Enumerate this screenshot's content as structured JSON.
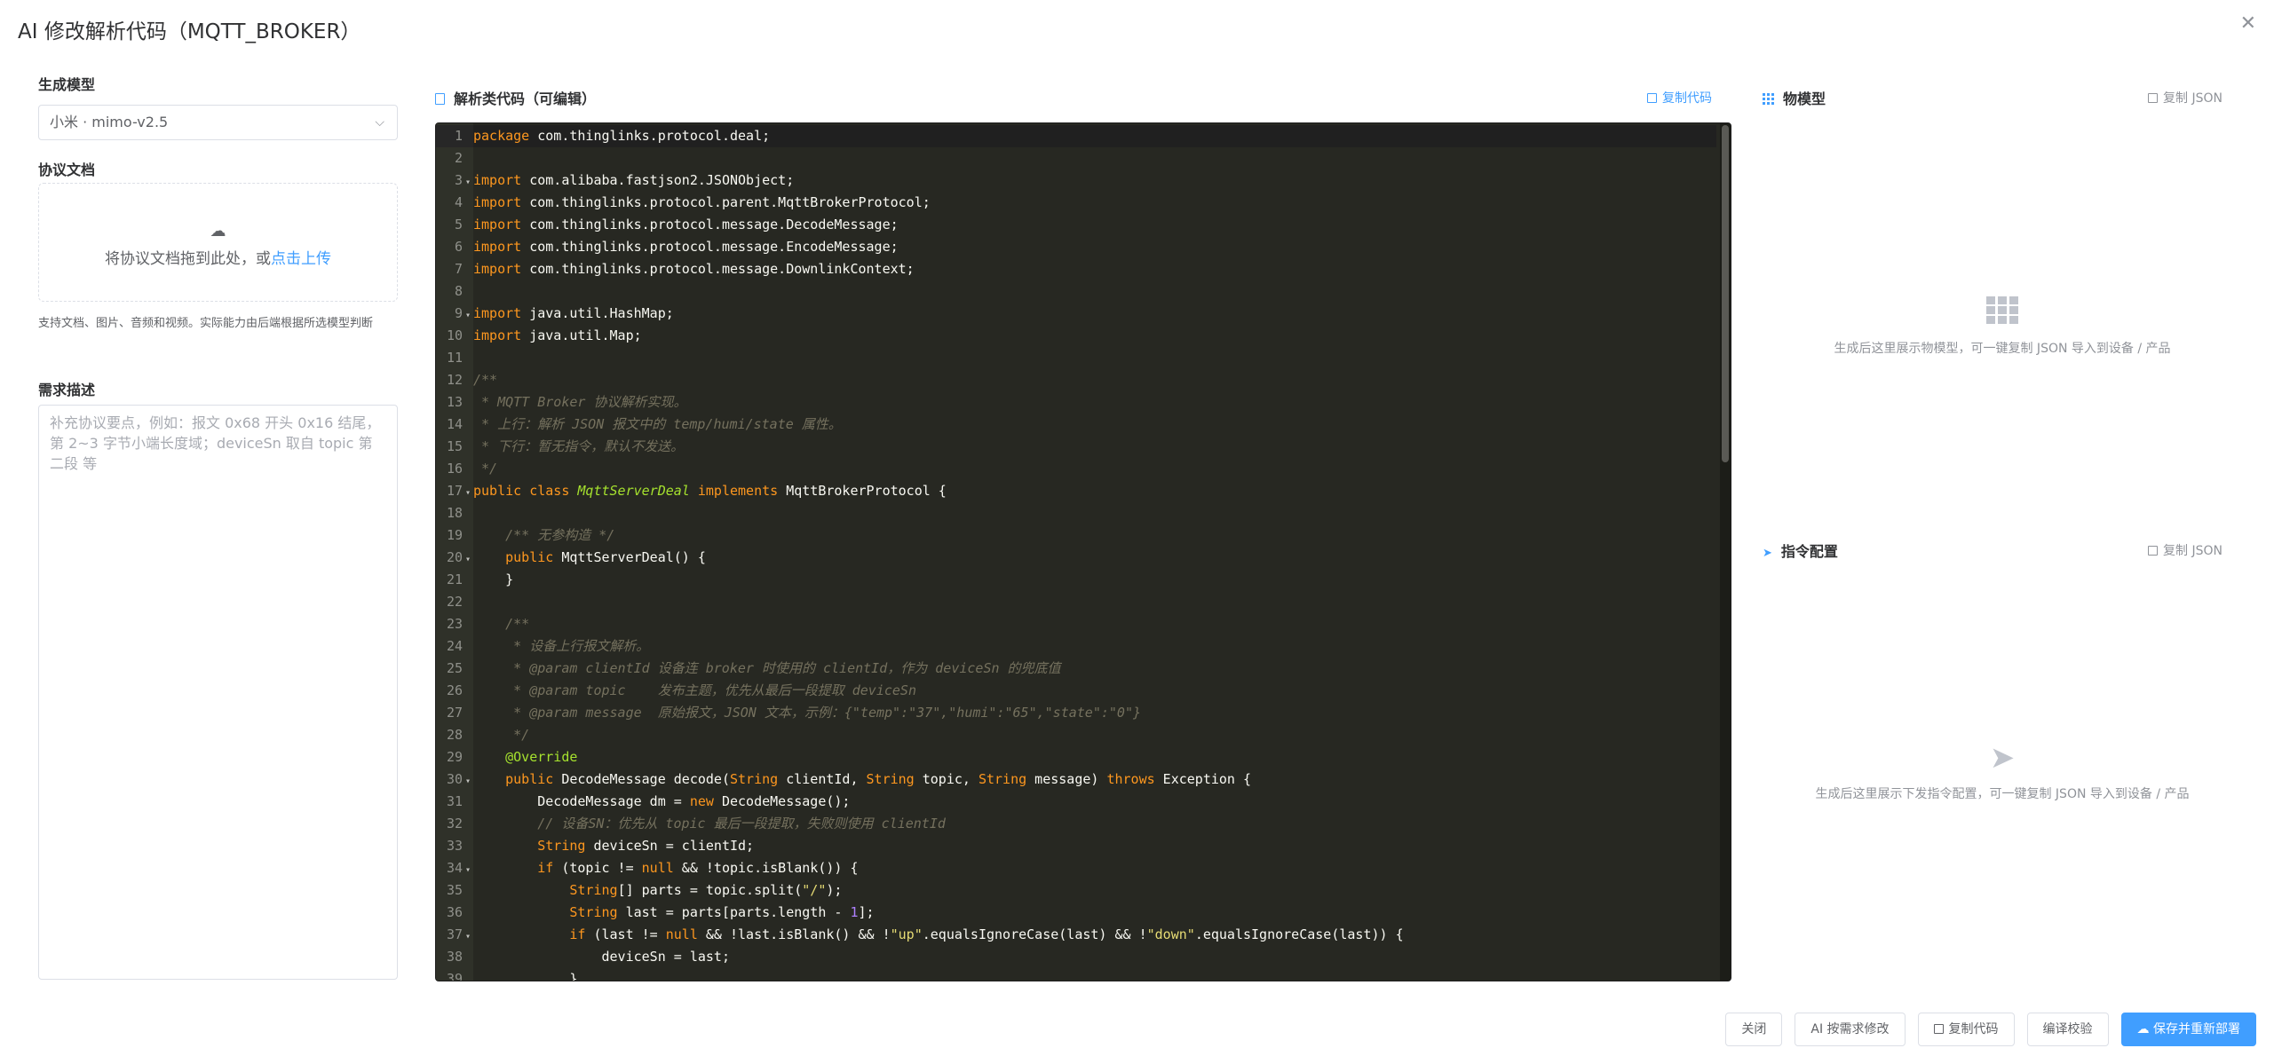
{
  "dialog": {
    "title": "AI 修改解析代码（MQTT_BROKER）",
    "close_icon": "close-icon"
  },
  "left": {
    "model_label": "生成模型",
    "model_value": "小米 · mimo-v2.5",
    "protocol_doc_label": "协议文档",
    "upload_text": "将协议文档拖到此处，或",
    "upload_link": "点击上传",
    "upload_hint": "支持文档、图片、音频和视频。实际能力由后端根据所选模型判断",
    "requirement_label": "需求描述",
    "requirement_placeholder": "补充协议要点，例如：报文 0x68 开头 0x16 结尾，第 2~3 字节小端长度域；deviceSn 取自 topic 第二段 等"
  },
  "middle": {
    "title": "解析类代码（可编辑）",
    "copy_label": "复制代码",
    "code_lines": [
      {
        "n": "1",
        "fold": false,
        "html": "<span class=\"kw\">package</span> com.thinglinks.protocol.deal;"
      },
      {
        "n": "2",
        "fold": false,
        "html": ""
      },
      {
        "n": "3",
        "fold": true,
        "html": "<span class=\"kw\">import</span> com.alibaba.fastjson2.JSONObject;"
      },
      {
        "n": "4",
        "fold": false,
        "html": "<span class=\"kw\">import</span> com.thinglinks.protocol.parent.MqttBrokerProtocol;"
      },
      {
        "n": "5",
        "fold": false,
        "html": "<span class=\"kw\">import</span> com.thinglinks.protocol.message.DecodeMessage;"
      },
      {
        "n": "6",
        "fold": false,
        "html": "<span class=\"kw\">import</span> com.thinglinks.protocol.message.EncodeMessage;"
      },
      {
        "n": "7",
        "fold": false,
        "html": "<span class=\"kw\">import</span> com.thinglinks.protocol.message.DownlinkContext;"
      },
      {
        "n": "8",
        "fold": false,
        "html": ""
      },
      {
        "n": "9",
        "fold": true,
        "html": "<span class=\"kw\">import</span> java.util.HashMap;"
      },
      {
        "n": "10",
        "fold": false,
        "html": "<span class=\"kw\">import</span> java.util.Map;"
      },
      {
        "n": "11",
        "fold": false,
        "html": ""
      },
      {
        "n": "12",
        "fold": false,
        "html": "<span class=\"cm\">/**</span>"
      },
      {
        "n": "13",
        "fold": false,
        "html": "<span class=\"cm\"> * MQTT Broker 协议解析实现。</span>"
      },
      {
        "n": "14",
        "fold": false,
        "html": "<span class=\"cm\"> * 上行：解析 JSON 报文中的 temp/humi/state 属性。</span>"
      },
      {
        "n": "15",
        "fold": false,
        "html": "<span class=\"cm\"> * 下行：暂无指令，默认不发送。</span>"
      },
      {
        "n": "16",
        "fold": false,
        "html": "<span class=\"cm\"> */</span>"
      },
      {
        "n": "17",
        "fold": true,
        "html": "<span class=\"kw\">public class</span> <span class=\"cls\">MqttServerDeal</span> <span class=\"kw\">implements</span> MqttBrokerProtocol {"
      },
      {
        "n": "18",
        "fold": false,
        "html": ""
      },
      {
        "n": "19",
        "fold": false,
        "html": "    <span class=\"cm\">/** 无参构造 */</span>"
      },
      {
        "n": "20",
        "fold": true,
        "html": "    <span class=\"kw\">public</span> MqttServerDeal() {"
      },
      {
        "n": "21",
        "fold": false,
        "html": "    }"
      },
      {
        "n": "22",
        "fold": false,
        "html": ""
      },
      {
        "n": "23",
        "fold": false,
        "html": "    <span class=\"cm\">/**</span>"
      },
      {
        "n": "24",
        "fold": false,
        "html": "<span class=\"cm\">     * 设备上行报文解析。</span>"
      },
      {
        "n": "25",
        "fold": false,
        "html": "<span class=\"cm\">     * @param clientId 设备连 broker 时使用的 clientId，作为 deviceSn 的兜底值</span>"
      },
      {
        "n": "26",
        "fold": false,
        "html": "<span class=\"cm\">     * @param topic    发布主题，优先从最后一段提取 deviceSn</span>"
      },
      {
        "n": "27",
        "fold": false,
        "html": "<span class=\"cm\">     * @param message  原始报文，JSON 文本，示例：{\"temp\":\"37\",\"humi\":\"65\",\"state\":\"0\"}</span>"
      },
      {
        "n": "28",
        "fold": false,
        "html": "<span class=\"cm\">     */</span>"
      },
      {
        "n": "29",
        "fold": false,
        "html": "    <span class=\"ann\">@Override</span>"
      },
      {
        "n": "30",
        "fold": true,
        "html": "    <span class=\"kw\">public</span> DecodeMessage decode(<span class=\"kw\">String</span> clientId, <span class=\"kw\">String</span> topic, <span class=\"kw\">String</span> message) <span class=\"kw\">throws</span> Exception {"
      },
      {
        "n": "31",
        "fold": false,
        "html": "        DecodeMessage dm = <span class=\"kw\">new</span> DecodeMessage();"
      },
      {
        "n": "32",
        "fold": false,
        "html": "        <span class=\"cm\">// 设备SN：优先从 topic 最后一段提取，失败则使用 clientId</span>"
      },
      {
        "n": "33",
        "fold": false,
        "html": "        <span class=\"kw\">String</span> deviceSn = clientId;"
      },
      {
        "n": "34",
        "fold": true,
        "html": "        <span class=\"kw\">if</span> (topic != <span class=\"kw\">null</span> &amp;&amp; !topic.isBlank()) {"
      },
      {
        "n": "35",
        "fold": false,
        "html": "            <span class=\"kw\">String</span>[] parts = topic.split(<span class=\"str\">\"/\"</span>);"
      },
      {
        "n": "36",
        "fold": false,
        "html": "            <span class=\"kw\">String</span> last = parts[parts.length - <span class=\"num\">1</span>];"
      },
      {
        "n": "37",
        "fold": true,
        "html": "            <span class=\"kw\">if</span> (last != <span class=\"kw\">null</span> &amp;&amp; !last.isBlank() &amp;&amp; !<span class=\"str\">\"up\"</span>.equalsIgnoreCase(last) &amp;&amp; !<span class=\"str\">\"down\"</span>.equalsIgnoreCase(last)) {"
      },
      {
        "n": "38",
        "fold": false,
        "html": "                deviceSn = last;"
      },
      {
        "n": "39",
        "fold": false,
        "html": "            }"
      }
    ]
  },
  "right": {
    "model": {
      "title": "物模型",
      "copy_label": "复制 JSON",
      "empty_text": "生成后这里展示物模型，可一键复制 JSON 导入到设备 / 产品"
    },
    "commands": {
      "title": "指令配置",
      "copy_label": "复制 JSON",
      "empty_text": "生成后这里展示下发指令配置，可一键复制 JSON 导入到设备 / 产品"
    }
  },
  "footer": {
    "close": "关闭",
    "ai_modify": "AI 按需求修改",
    "copy_code": "复制代码",
    "compile_check": "编译校验",
    "save_redeploy": "保存并重新部署"
  },
  "colors": {
    "accent": "#409eff",
    "editor_bg": "#272822",
    "keyword": "#fd971f",
    "comment": "#75715e",
    "string": "#e6db74",
    "annotation": "#a6e22e"
  }
}
